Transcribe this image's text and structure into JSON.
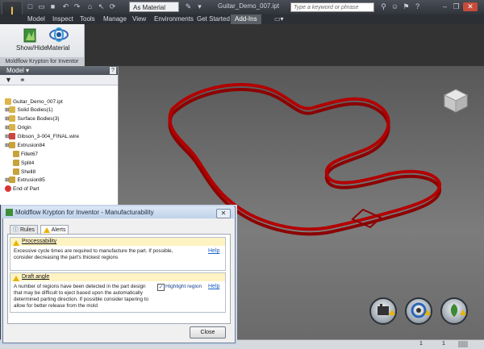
{
  "titlebar": {
    "app_button_label": "I",
    "material_dropdown": "As Material",
    "document_title": "Guitar_Demo_007.ipt",
    "search_placeholder": "Type a keyword or phrase"
  },
  "menu_tabs": [
    "Model",
    "Inspect",
    "Tools",
    "Manage",
    "View",
    "Environments",
    "Get Started",
    "Add-Ins"
  ],
  "active_tab": "Add-Ins",
  "ribbon": {
    "buttons": [
      {
        "label": "Show/Hide",
        "icon": "show-hide-icon"
      },
      {
        "label": "Material",
        "icon": "material-icon"
      }
    ],
    "panel_title": "Moldflow Krypton for Inventor"
  },
  "browser": {
    "header": "Model",
    "tree": [
      {
        "label": "Guitar_Demo_007.ipt",
        "icon": "part-icon"
      },
      {
        "label": "Solid Bodies(1)",
        "icon": "folder-icon"
      },
      {
        "label": "Surface Bodies(3)",
        "icon": "folder-icon"
      },
      {
        "label": "Origin",
        "icon": "folder-icon"
      },
      {
        "label": "Gibson_3-004_FINAL.wire",
        "icon": "wire-icon"
      },
      {
        "label": "Extrusion84",
        "icon": "extrusion-icon"
      },
      {
        "label": "Fillet67",
        "icon": "fillet-icon"
      },
      {
        "label": "Split4",
        "icon": "split-icon"
      },
      {
        "label": "Shell8",
        "icon": "shell-icon"
      },
      {
        "label": "Extrusion85",
        "icon": "extrusion-icon"
      },
      {
        "label": "End of Part",
        "icon": "end-of-part-icon"
      }
    ]
  },
  "dialog": {
    "title": "Moldflow Krypton for Inventor - Manufacturability",
    "tabs": [
      "Rules",
      "Alerts"
    ],
    "active_tab": "Alerts",
    "alerts": [
      {
        "title": "Processability",
        "text": "Excessive cycle times are required to manufacture the part. If possible, consider decreasing the part's thickest regions",
        "help": "Help"
      },
      {
        "title": "Draft angle",
        "text": "A number of regions have been detected in the part design that may be difficult to eject based upon the automatically determined parting direction. If possible consider tapering to allow for better release from the mold",
        "checkbox_label": "Highlight region",
        "checkbox_checked": true,
        "help": "Help"
      }
    ],
    "close_label": "Close"
  },
  "statusbar": {
    "count1": "1",
    "count2": "1"
  },
  "colors": {
    "part_red": "#a00000",
    "accent_blue": "#1a5fc4",
    "warning": "#e8b400"
  }
}
